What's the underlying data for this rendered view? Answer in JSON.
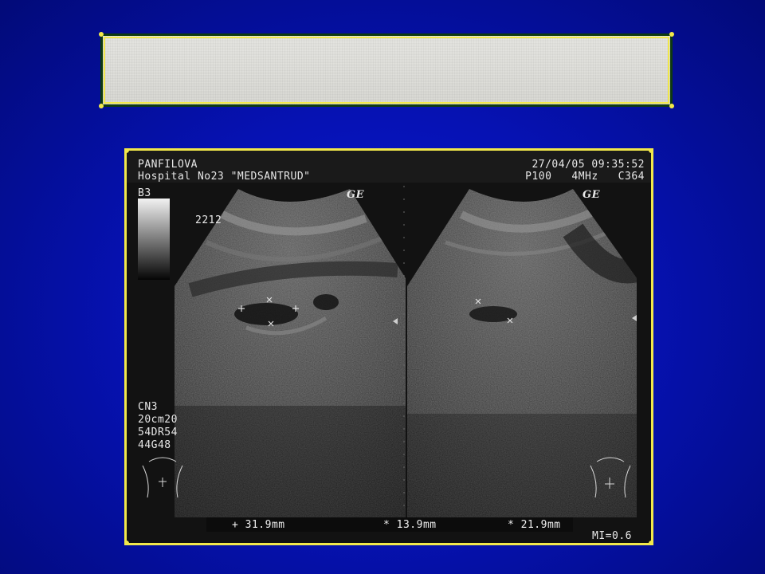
{
  "header": {
    "patient": "PANFILOVA",
    "hospital": "Hospital No23 \"MEDSANTRUD\"",
    "datetime": "27/04/05 09:35:52",
    "probe_info": "P100   4MHz   C364"
  },
  "left_panel": {
    "preset": "B3",
    "depth_marker": "2212",
    "settings": [
      "CN3",
      "20cm20",
      "54DR54",
      "44G48"
    ]
  },
  "brand": {
    "left": "GE",
    "right": "GE"
  },
  "measurements": {
    "m1": "31.9mm",
    "m2": "13.9mm",
    "m3": "21.9mm"
  },
  "footer": {
    "mi": "MI=0.6"
  },
  "colors": {
    "background": "#0612b4",
    "frame_border": "#f2e84a",
    "banner_border": "#0f3a10"
  }
}
